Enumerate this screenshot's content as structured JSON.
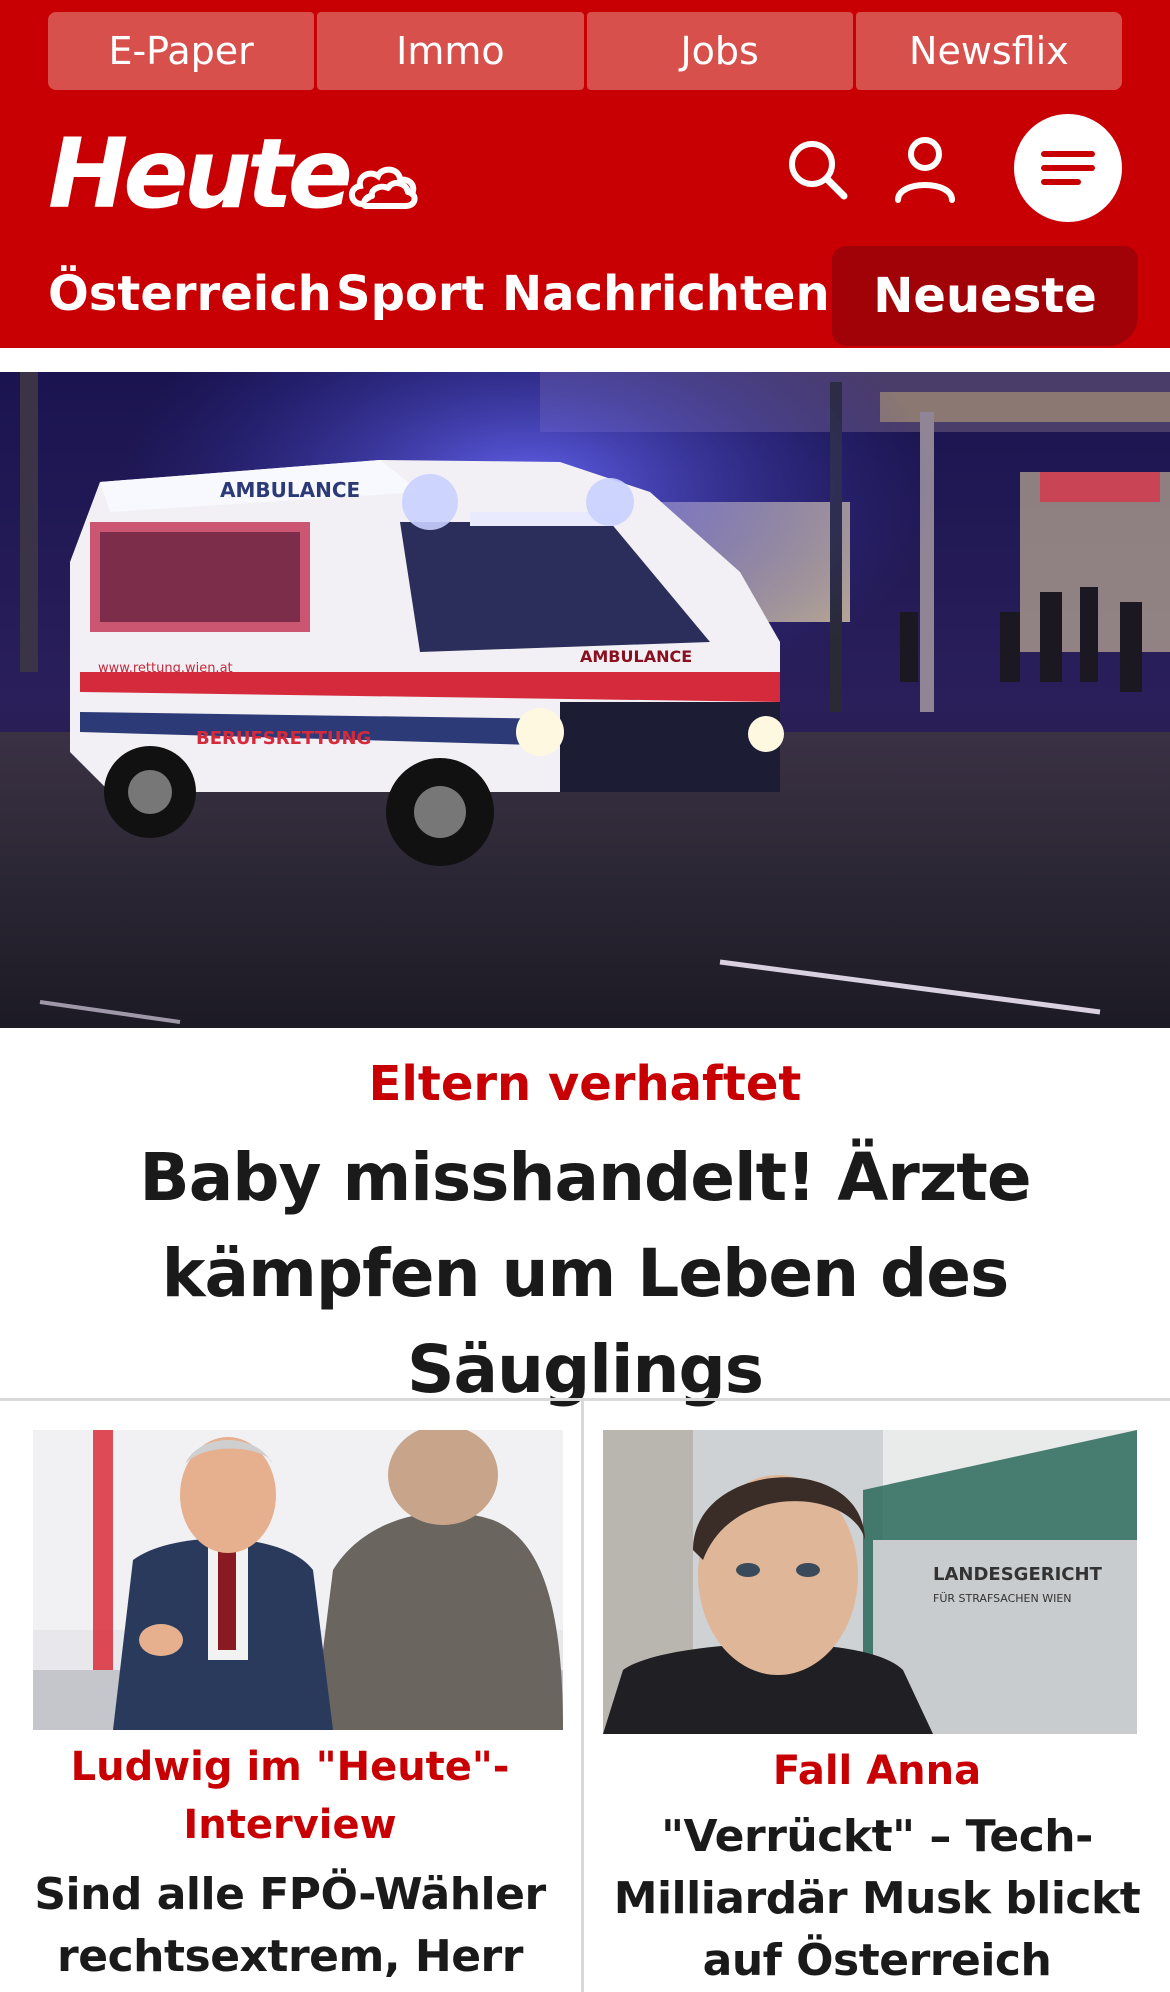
{
  "topnav": {
    "items": [
      "E-Paper",
      "Immo",
      "Jobs",
      "Newsflix"
    ]
  },
  "brand": {
    "logo": "Heute",
    "color": "#c80003"
  },
  "sections": {
    "items": [
      "Österreich",
      "Sport",
      "Nachrichten"
    ],
    "active": "Neueste"
  },
  "hero": {
    "kicker": "Eltern verhaftet",
    "title": "Baby misshandelt! Ärzte kämpfen um Leben des Säuglings",
    "image_texts": {
      "side": "AMBULANCE",
      "front": "AMBULANCE",
      "stripe": "BERUFSRETTUNG",
      "url": "www.rettung.wien.at"
    }
  },
  "cards": [
    {
      "kicker": "Ludwig im \"Heute\"-Interview",
      "title": "Sind alle FPÖ-Wähler rechtsextrem, Herr Bürgermeister?"
    },
    {
      "kicker": "Fall Anna",
      "title": "\"Verrückt\" – Tech-Milliardär Musk blickt auf Österreich",
      "image_texts": {
        "sign1": "LANDESGERICHT",
        "sign2": "FÜR STRAFSACHEN WIEN"
      }
    }
  ],
  "icons": [
    "weather-cloud-icon",
    "search-icon",
    "user-icon",
    "menu-icon"
  ]
}
